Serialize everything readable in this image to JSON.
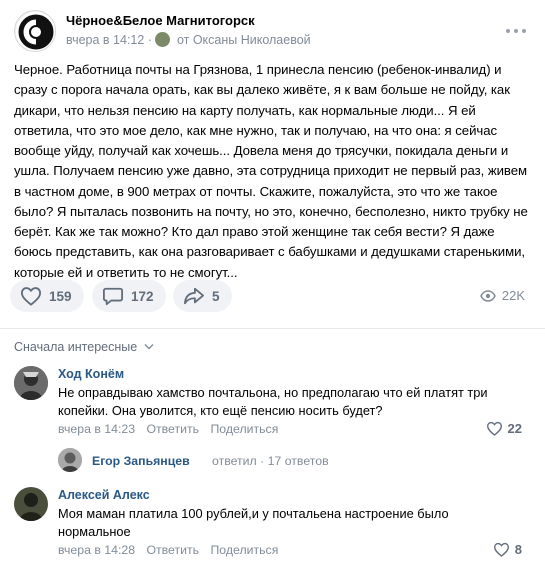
{
  "post": {
    "group_name": "Чёрное&Белое Магнитогорск",
    "time": "вчера в 14:12",
    "from_text": "от Оксаны Николаевой",
    "text": "Черное. Работница почты на Грязнова, 1 принесла пенсию (ребенок-инвалид) и сразу с порога начала орать, как вы далеко живёте, я к вам больше не пойду, как дикари, что нельзя пенсию на карту получать, как нормальные люди... Я ей ответила, что это мое дело, как мне нужно, так и получаю, на что она: я сейчас вообще уйду, получай как хочешь... Довела меня до трясучки, покидала деньги и ушла. Получаем пенсию уже давно, эта сотрудница приходит не первый раз, живем в частном доме, в 900 метрах от почты. Скажите, пожалуйста, это что же такое было? Я пыталась позвонить на почту, но это, конечно, бесполезно, никто трубку не берёт. Как же так можно? Кто дал право этой женщине так себя вести? Я даже боюсь представить, как она разговаривает с бабушками и дедушками старенькими, которые ей и ответить то не смогут...",
    "likes": "159",
    "comments": "172",
    "shares": "5",
    "views": "22K"
  },
  "sort_label": "Сначала интересные",
  "comments": [
    {
      "author": "Ход Конём",
      "text": "Не оправдываю хамство почтальона, но предполагаю что ей платят три копейки. Она уволится, кто ещё пенсию носить будет?",
      "time": "вчера в 14:23",
      "reply_label": "Ответить",
      "share_label": "Поделиться",
      "likes": "22"
    },
    {
      "author": "Алексей Алекс",
      "text": "Моя маман платила 100 рублей,и у почтальена настроение было нормальное",
      "time": "вчера в 14:28",
      "reply_label": "Ответить",
      "share_label": "Поделиться",
      "likes": "8"
    }
  ],
  "replies": {
    "name": "Егор Запьянцев",
    "rest": "ответил · 17 ответов"
  },
  "colors": {
    "link": "#2a5885",
    "muted": "#818c99",
    "button_bg": "#f0f2f5"
  }
}
